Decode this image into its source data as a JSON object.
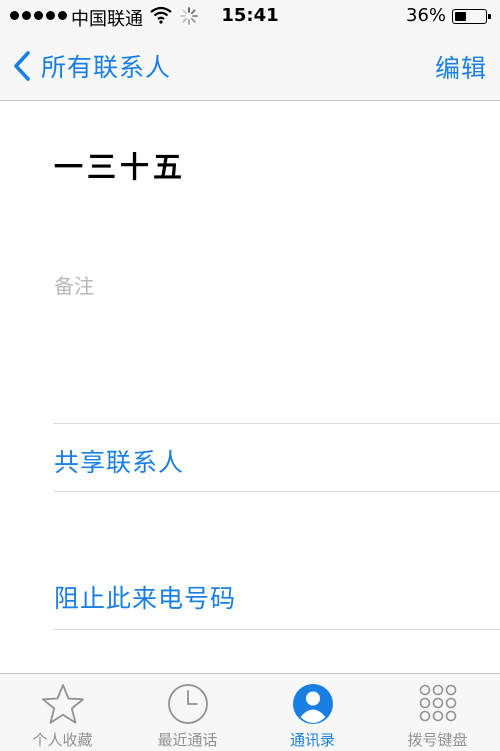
{
  "status_bar": {
    "carrier": "中国联通",
    "time": "15:41",
    "battery_percent": "36%",
    "battery_level": 0.36,
    "signal_bars": 5
  },
  "nav": {
    "back_label": "所有联系人",
    "edit_label": "编辑"
  },
  "contact": {
    "name": "一三十五",
    "notes_placeholder": "备注"
  },
  "actions": {
    "share": "共享联系人",
    "block": "阻止此来电号码"
  },
  "tabbar": {
    "tabs": [
      {
        "label": "个人收藏",
        "icon": "star-icon",
        "active": false
      },
      {
        "label": "最近通话",
        "icon": "clock-icon",
        "active": false
      },
      {
        "label": "通讯录",
        "icon": "contacts-icon",
        "active": true
      },
      {
        "label": "拨号键盘",
        "icon": "keypad-icon",
        "active": false
      }
    ]
  },
  "colors": {
    "accent": "#1a7fe3",
    "inactive": "#929292",
    "placeholder": "#b7b7bc"
  }
}
